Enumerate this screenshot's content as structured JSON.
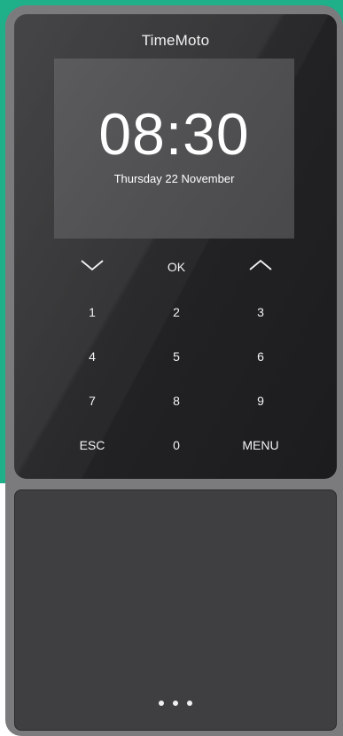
{
  "brand": "TimeMoto",
  "screen": {
    "time": "08:30",
    "date": "Thursday 22 November"
  },
  "keypad": {
    "down_icon": "chevron-down-icon",
    "ok": "OK",
    "up_icon": "chevron-up-icon",
    "k1": "1",
    "k2": "2",
    "k3": "3",
    "k4": "4",
    "k5": "5",
    "k6": "6",
    "k7": "7",
    "k8": "8",
    "k9": "9",
    "esc": "ESC",
    "k0": "0",
    "menu": "MENU"
  },
  "sensor": {
    "indicator_icon": "three-dots-icon"
  },
  "colors": {
    "background_accent": "#1fb08a",
    "device_frame": "#7b7b7d",
    "front_panel": "#2a2a2c",
    "screen": "#555557",
    "sensor_panel": "#3f3f41"
  }
}
